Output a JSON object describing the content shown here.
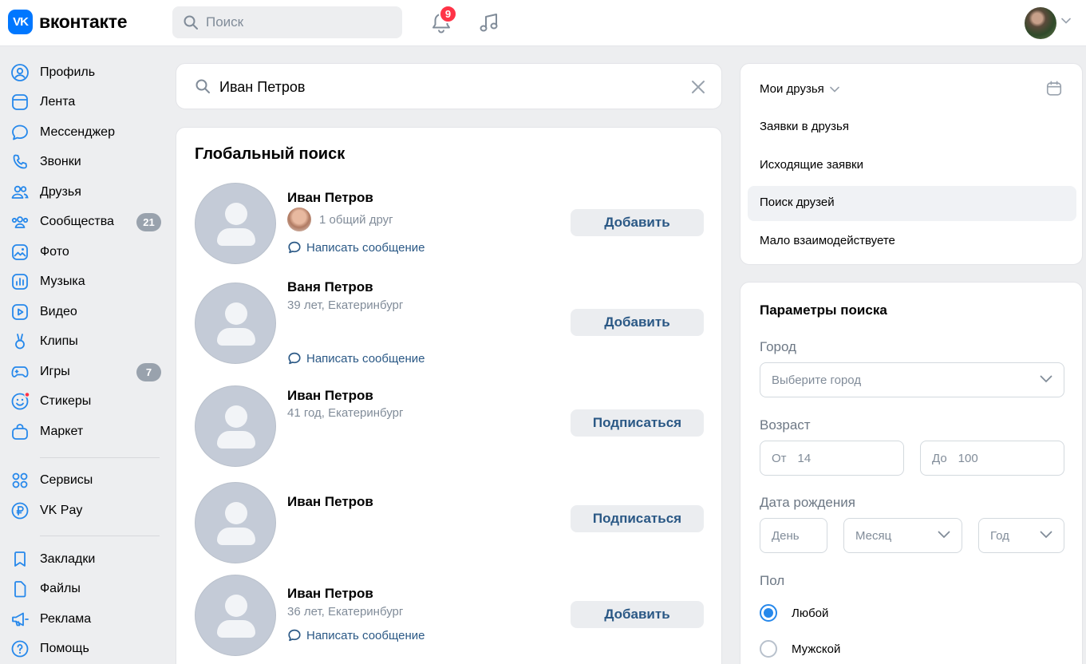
{
  "header": {
    "logo_badge": "VK",
    "logo_text": "вконтакте",
    "search_placeholder": "Поиск",
    "notifications_count": "9"
  },
  "sidebar": {
    "items": [
      {
        "label": "Профиль",
        "icon": "user-circle-icon"
      },
      {
        "label": "Лента",
        "icon": "feed-icon"
      },
      {
        "label": "Мессенджер",
        "icon": "message-icon"
      },
      {
        "label": "Звонки",
        "icon": "phone-icon"
      },
      {
        "label": "Друзья",
        "icon": "friends-icon"
      },
      {
        "label": "Сообщества",
        "icon": "communities-icon",
        "count": "21"
      },
      {
        "label": "Фото",
        "icon": "photo-icon"
      },
      {
        "label": "Музыка",
        "icon": "music-square-icon"
      },
      {
        "label": "Видео",
        "icon": "video-icon"
      },
      {
        "label": "Клипы",
        "icon": "clips-icon"
      },
      {
        "label": "Игры",
        "icon": "gamepad-icon",
        "count": "7"
      },
      {
        "label": "Стикеры",
        "icon": "smile-icon"
      },
      {
        "label": "Маркет",
        "icon": "bag-icon"
      },
      {
        "label": "Сервисы",
        "icon": "services-icon"
      },
      {
        "label": "VK Pay",
        "icon": "ruble-icon"
      },
      {
        "label": "Закладки",
        "icon": "bookmark-icon"
      },
      {
        "label": "Файлы",
        "icon": "file-icon"
      },
      {
        "label": "Реклама",
        "icon": "megaphone-icon"
      },
      {
        "label": "Помощь",
        "icon": "help-icon"
      }
    ]
  },
  "search": {
    "query": "Иван Петров"
  },
  "results": {
    "title": "Глобальный поиск",
    "people": [
      {
        "name": "Иван Петров",
        "mutual": "1 общий друг",
        "message": "Написать сообщение",
        "action": "Добавить"
      },
      {
        "name": "Ваня Петров",
        "info": "39 лет, Екатеринбург",
        "message": "Написать сообщение",
        "action": "Добавить"
      },
      {
        "name": "Иван Петров",
        "info": "41 год, Екатеринбург",
        "action": "Подписаться"
      },
      {
        "name": "Иван Петров",
        "action": "Подписаться"
      },
      {
        "name": "Иван Петров",
        "info": "36 лет, Екатеринбург",
        "message": "Написать сообщение",
        "action": "Добавить"
      }
    ]
  },
  "friends_menu": {
    "my_friends": "Мои друзья",
    "requests": "Заявки в друзья",
    "outgoing": "Исходящие заявки",
    "search_friends": "Поиск друзей",
    "low_interaction": "Мало взаимодействуете"
  },
  "params": {
    "title": "Параметры поиска",
    "city_label": "Город",
    "city_placeholder": "Выберите город",
    "age_label": "Возраст",
    "age_from_label": "От",
    "age_from_value": "14",
    "age_to_label": "До",
    "age_to_value": "100",
    "birth_label": "Дата рождения",
    "day_placeholder": "День",
    "month_placeholder": "Месяц",
    "year_placeholder": "Год",
    "gender_label": "Пол",
    "gender_any": "Любой",
    "gender_male": "Мужской"
  }
}
